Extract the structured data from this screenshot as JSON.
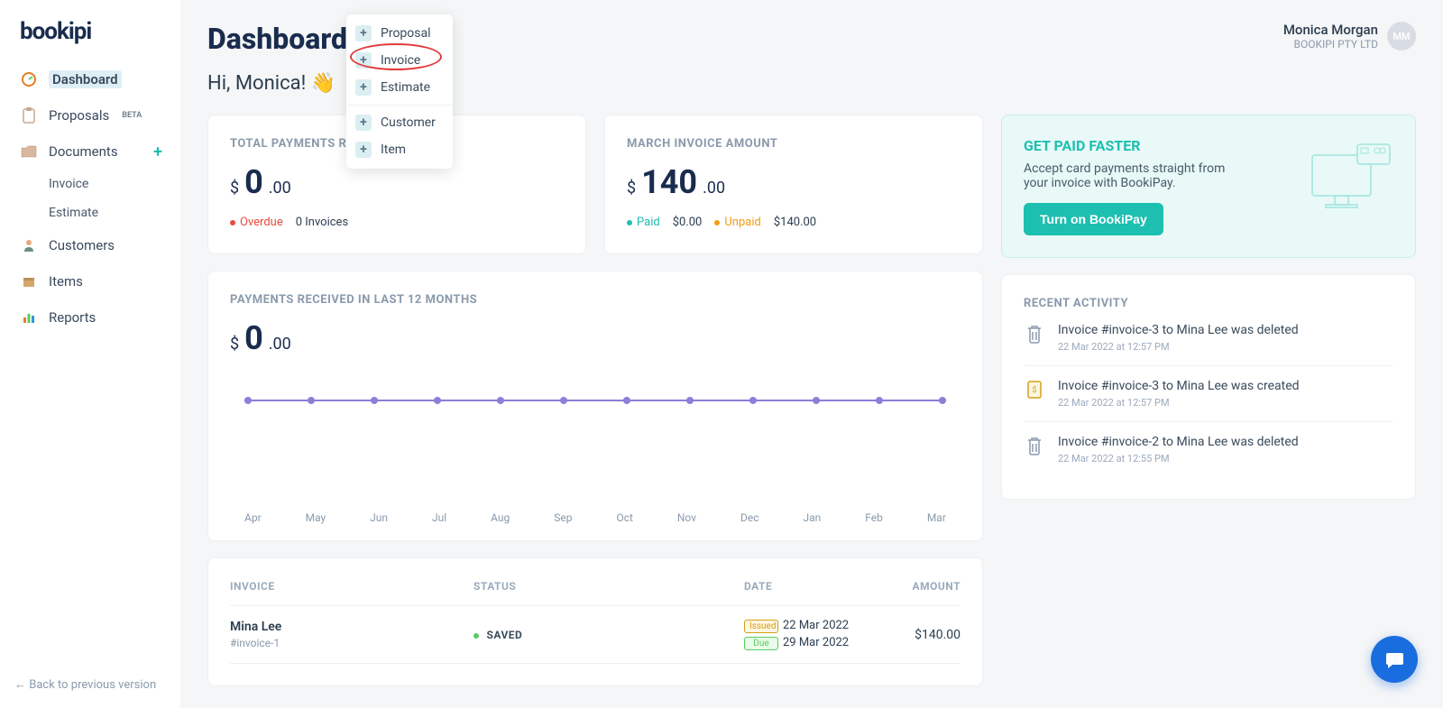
{
  "brand": "bookipi",
  "nav": {
    "dashboard": "Dashboard",
    "proposals": "Proposals",
    "proposals_badge": "BETA",
    "documents": "Documents",
    "invoice": "Invoice",
    "estimate": "Estimate",
    "customers": "Customers",
    "items": "Items",
    "reports": "Reports",
    "back": "Back to previous version"
  },
  "header": {
    "title": "Dashboard",
    "greeting": "Hi, Monica! 👋",
    "user_name": "Monica Morgan",
    "user_company": "BOOKIPI PTY LTD",
    "user_initials": "MM"
  },
  "dropdown": {
    "proposal": "Proposal",
    "invoice": "Invoice",
    "estimate": "Estimate",
    "customer": "Customer",
    "item": "Item"
  },
  "cards": {
    "total_payments": {
      "title": "TOTAL PAYMENTS RECEIVED",
      "currency": "$",
      "whole": "0",
      "dec": ".00",
      "overdue_label": "Overdue",
      "overdue_count": "0 Invoices"
    },
    "month_invoice": {
      "title": "MARCH INVOICE AMOUNT",
      "currency": "$",
      "whole": "140",
      "dec": ".00",
      "paid_label": "Paid",
      "paid_amount": "$0.00",
      "unpaid_label": "Unpaid",
      "unpaid_amount": "$140.00"
    },
    "promo": {
      "title": "GET PAID FASTER",
      "text": "Accept card payments straight from your invoice with BookiPay.",
      "button": "Turn on BookiPay"
    },
    "payments_chart": {
      "title": "PAYMENTS RECEIVED IN LAST 12 MONTHS",
      "currency": "$",
      "whole": "0",
      "dec": ".00"
    },
    "activity": {
      "title": "RECENT ACTIVITY",
      "items": [
        {
          "icon": "trash",
          "text": "Invoice #invoice-3 to Mina Lee was deleted",
          "time": "22 Mar 2022 at 12:57 PM"
        },
        {
          "icon": "doc",
          "text": "Invoice #invoice-3 to Mina Lee was created",
          "time": "22 Mar 2022 at 12:57 PM"
        },
        {
          "icon": "trash",
          "text": "Invoice #invoice-2 to Mina Lee was deleted",
          "time": "22 Mar 2022 at 12:55 PM"
        }
      ]
    },
    "table": {
      "col_invoice": "INVOICE",
      "col_status": "STATUS",
      "col_date": "DATE",
      "col_amount": "AMOUNT",
      "row": {
        "name": "Mina Lee",
        "ref": "#invoice-1",
        "status": "SAVED",
        "issued_label": "Issued",
        "issued_date": "22 Mar 2022",
        "due_label": "Due",
        "due_date": "29 Mar 2022",
        "amount": "$140.00"
      }
    }
  },
  "chart_data": {
    "type": "line",
    "title": "Payments received in last 12 months",
    "xlabel": "",
    "ylabel": "$",
    "ylim": [
      0,
      0
    ],
    "categories": [
      "Apr",
      "May",
      "Jun",
      "Jul",
      "Aug",
      "Sep",
      "Oct",
      "Nov",
      "Dec",
      "Jan",
      "Feb",
      "Mar"
    ],
    "values": [
      0,
      0,
      0,
      0,
      0,
      0,
      0,
      0,
      0,
      0,
      0,
      0
    ]
  }
}
